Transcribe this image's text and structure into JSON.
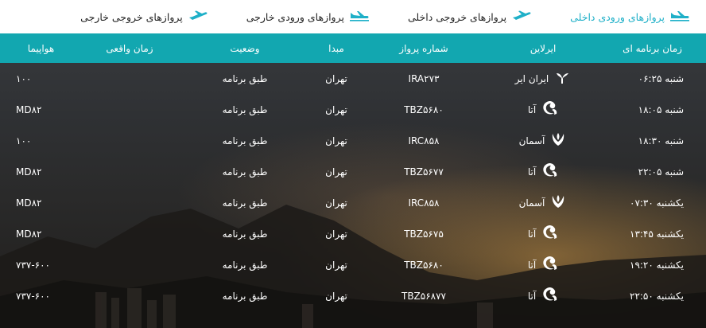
{
  "tabs": [
    {
      "label": "پروازهای ورودی داخلی",
      "active": true,
      "icon": "plane-landing-icon"
    },
    {
      "label": "پروازهای خروجی داخلی",
      "active": false,
      "icon": "plane-takeoff-icon"
    },
    {
      "label": "پروازهای ورودی خارجی",
      "active": false,
      "icon": "plane-landing-icon"
    },
    {
      "label": "پروازهای خروجی خارجی",
      "active": false,
      "icon": "plane-takeoff-icon"
    }
  ],
  "columns": {
    "scheduled": "زمان برنامه ای",
    "airline": "ایرلاین",
    "flight_no": "شماره پرواز",
    "origin": "مبدا",
    "status": "وضعیت",
    "actual": "زمان واقعی",
    "aircraft": "هواپیما"
  },
  "rows": [
    {
      "scheduled": "شنبه ۰۶:۲۵",
      "airline": "ایران ایر",
      "logo": "iranair-logo-icon",
      "flight_no": "IRA۲۷۳",
      "origin": "تهران",
      "status": "طبق برنامه",
      "actual": "",
      "aircraft": "۱۰۰"
    },
    {
      "scheduled": "شنبه ۱۸:۰۵",
      "airline": "آتا",
      "logo": "ata-logo-icon",
      "flight_no": "TBZ۵۶۸۰",
      "origin": "تهران",
      "status": "طبق برنامه",
      "actual": "",
      "aircraft": "MD۸۲"
    },
    {
      "scheduled": "شنبه ۱۸:۳۰",
      "airline": "آسمان",
      "logo": "aseman-logo-icon",
      "flight_no": "IRC۸۵۸",
      "origin": "تهران",
      "status": "طبق برنامه",
      "actual": "",
      "aircraft": "۱۰۰"
    },
    {
      "scheduled": "شنبه ۲۲:۰۵",
      "airline": "آتا",
      "logo": "ata-logo-icon",
      "flight_no": "TBZ۵۶۷۷",
      "origin": "تهران",
      "status": "طبق برنامه",
      "actual": "",
      "aircraft": "MD۸۲"
    },
    {
      "scheduled": "یکشنبه ۰۷:۳۰",
      "airline": "آسمان",
      "logo": "aseman-logo-icon",
      "flight_no": "IRC۸۵۸",
      "origin": "تهران",
      "status": "طبق برنامه",
      "actual": "",
      "aircraft": "MD۸۲"
    },
    {
      "scheduled": "یکشنبه ۱۳:۴۵",
      "airline": "آتا",
      "logo": "ata-logo-icon",
      "flight_no": "TBZ۵۶۷۵",
      "origin": "تهران",
      "status": "طبق برنامه",
      "actual": "",
      "aircraft": "MD۸۲"
    },
    {
      "scheduled": "یکشنبه ۱۹:۲۰",
      "airline": "آتا",
      "logo": "ata-logo-icon",
      "flight_no": "TBZ۵۶۸۰",
      "origin": "تهران",
      "status": "طبق برنامه",
      "actual": "",
      "aircraft": "۷۳۷-۶۰۰"
    },
    {
      "scheduled": "یکشنبه ۲۲:۵۰",
      "airline": "آتا",
      "logo": "ata-logo-icon",
      "flight_no": "TBZ۵۶۸۷۷",
      "origin": "تهران",
      "status": "طبق برنامه",
      "actual": "",
      "aircraft": "۷۳۷-۶۰۰"
    }
  ],
  "colors": {
    "accent": "#1fb0c8",
    "header_bg": "#12a7b0",
    "topbar_bg": "#ffffff"
  }
}
